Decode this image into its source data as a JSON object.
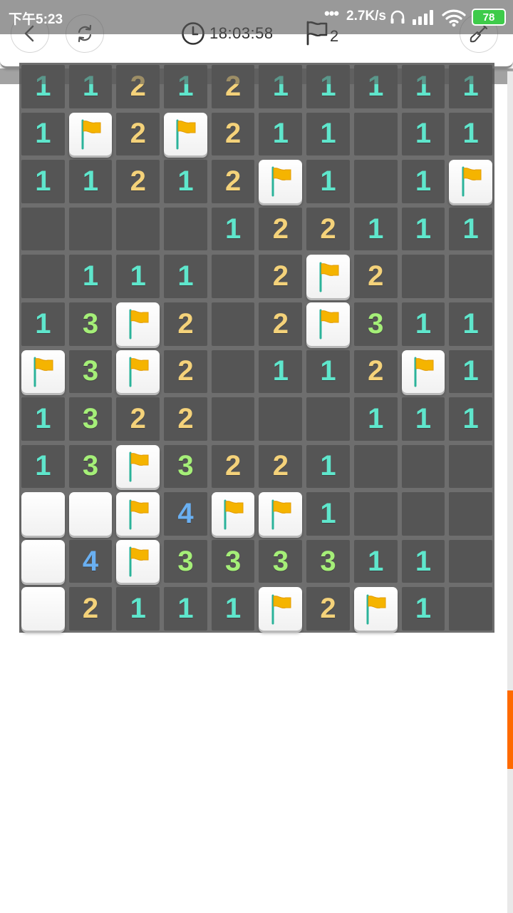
{
  "status_bar": {
    "time": "下午5:23",
    "network_speed": "2.7K/s",
    "battery": "78",
    "icons": [
      "more-dots-icon",
      "headphones-icon",
      "signal-icon",
      "wifi-icon",
      "battery-icon"
    ]
  },
  "toolbar": {
    "back_icon": "chevron-left-icon",
    "restart_icon": "refresh-icon",
    "timer_icon": "clock-icon",
    "timer": "18:03:58",
    "flag_icon": "flag-outline-icon",
    "flag_count": "2",
    "tool_icon": "shovel-icon"
  },
  "board": {
    "columns": 10,
    "rows": [
      [
        "1",
        "1",
        "2",
        "1",
        "2",
        "1",
        "1",
        "1",
        "1",
        "1"
      ],
      [
        "1",
        "F",
        "2",
        "F",
        "2",
        "1",
        "1",
        "",
        "1",
        "1"
      ],
      [
        "1",
        "1",
        "2",
        "1",
        "2",
        "F",
        "1",
        "",
        "1",
        "F"
      ],
      [
        "",
        "",
        "",
        "",
        "1",
        "2",
        "2",
        "1",
        "1",
        "1"
      ],
      [
        "",
        "1",
        "1",
        "1",
        "",
        "2",
        "F",
        "2",
        "",
        ""
      ],
      [
        "1",
        "3",
        "F",
        "2",
        "",
        "2",
        "F",
        "3",
        "1",
        "1"
      ],
      [
        "F",
        "3",
        "F",
        "2",
        "",
        "1",
        "1",
        "2",
        "F",
        "1"
      ],
      [
        "1",
        "3",
        "2",
        "2",
        "",
        "",
        "",
        "1",
        "1",
        "1"
      ],
      [
        "1",
        "3",
        "F",
        "3",
        "2",
        "2",
        "1",
        "",
        "",
        ""
      ],
      [
        "U",
        "U",
        "F",
        "4",
        "F",
        "F",
        "1",
        "",
        "",
        ""
      ],
      [
        "U",
        "4",
        "F",
        "3",
        "3",
        "3",
        "3",
        "1",
        "1",
        ""
      ],
      [
        "U",
        "2",
        "1",
        "1",
        "1",
        "F",
        "2",
        "F",
        "1",
        ""
      ]
    ],
    "legend": {
      "F": "flag",
      "U": "unopened",
      "": "empty-revealed"
    },
    "number_colors": {
      "1": "#5fe6cc",
      "2": "#f4d27a",
      "3": "#a5ef78",
      "4": "#6ab0f2"
    },
    "flag_color": "#f5b400",
    "pole_color": "#2bb39a"
  },
  "scrollbar": {
    "thumb_color": "#ff6a00"
  }
}
